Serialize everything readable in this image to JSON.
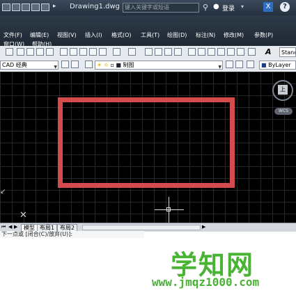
{
  "titlebar": {
    "document_title": "Drawing1.dwg",
    "search_placeholder": "键入关键字或短语",
    "login_label": "登录",
    "exchange_icon": "x-icon",
    "help_label": "?"
  },
  "menu": {
    "row1": [
      "文件(F)",
      "编辑(E)",
      "视图(V)",
      "插入(I)",
      "格式(O)",
      "工具(T)",
      "绘图(D)",
      "标注(N)",
      "修改(M)",
      "参数(P)"
    ],
    "row2": [
      "窗口(W)",
      "帮助(H)"
    ]
  },
  "toolbar": {
    "text_style": "Stanc"
  },
  "toolbar2": {
    "workspace": "CAD 经典",
    "layer": "制图",
    "linetype": "ByLayer"
  },
  "viewcube": {
    "face": "上",
    "wcs": "WCS"
  },
  "tabs": [
    "模型",
    "布局1",
    "布局2"
  ],
  "command_line": "下一点或 [闭合(C)/放弃(U)]:",
  "watermark": {
    "title": "学知网",
    "url": "www.jmqz1000.com"
  },
  "colors": {
    "rectangle": "#d44b4d",
    "canvas": "#000000",
    "watermark": "#49b334"
  }
}
